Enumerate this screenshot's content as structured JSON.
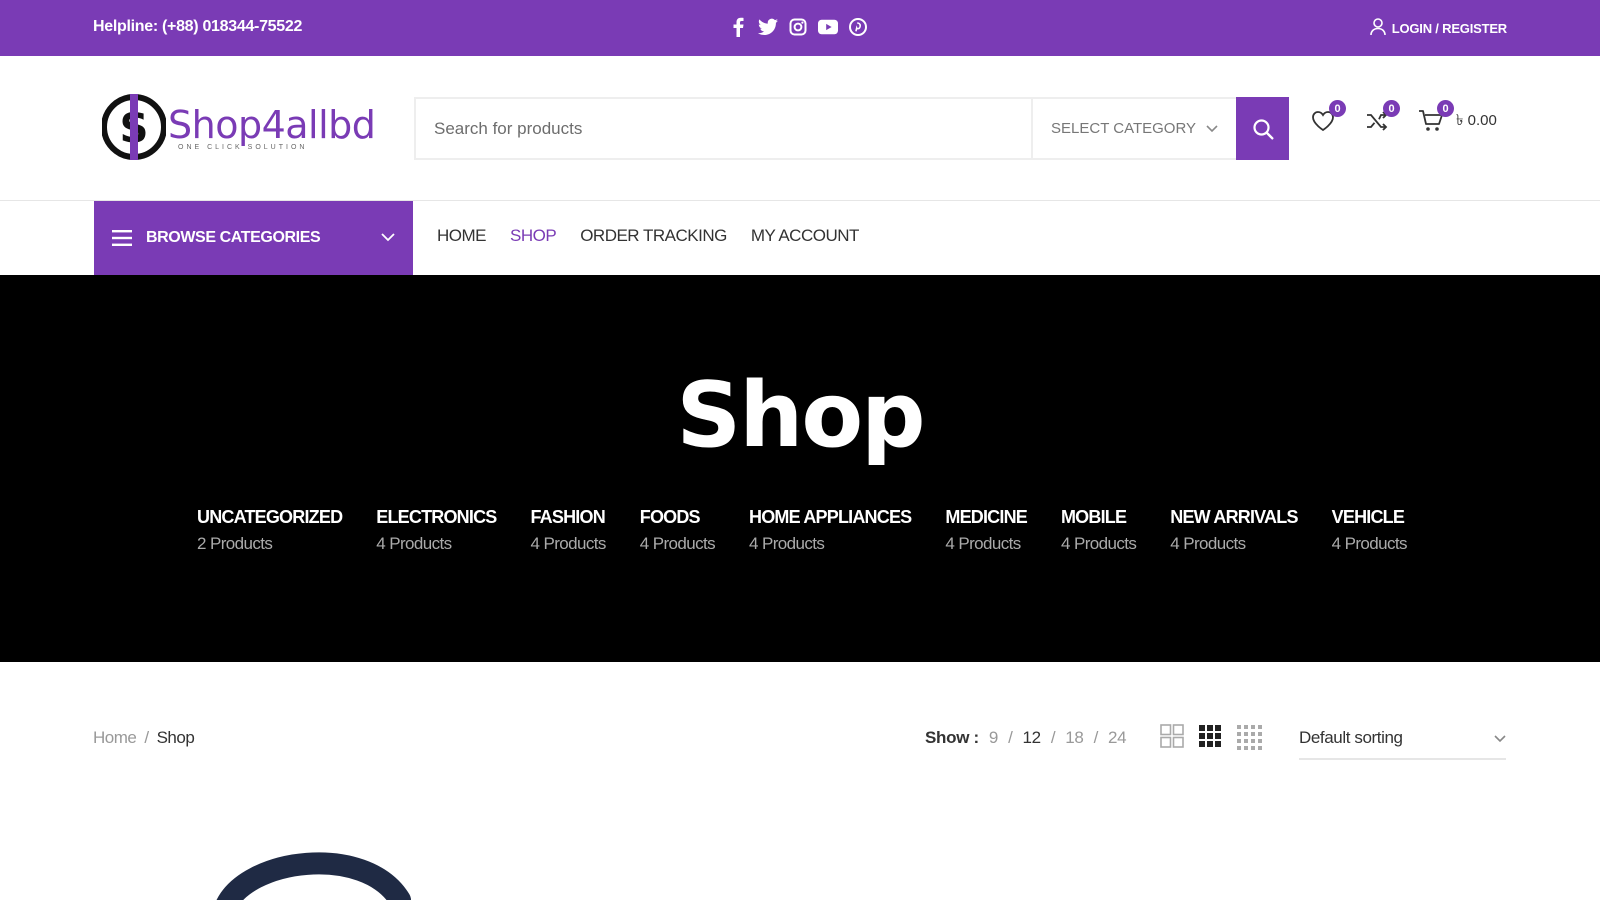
{
  "topbar": {
    "helpline": "Helpline: (+88) 018344-75522",
    "login_label": "LOGIN / REGISTER",
    "socials": [
      "facebook-icon",
      "twitter-icon",
      "instagram-icon",
      "youtube-icon",
      "pinterest-icon"
    ]
  },
  "header": {
    "logo": {
      "brand": "Shop4allbd",
      "tagline": "ONE CLICK SOLUTION"
    },
    "search": {
      "placeholder": "Search for products",
      "category_label": "SELECT CATEGORY"
    },
    "wishlist_count": "0",
    "compare_count": "0",
    "cart_count": "0",
    "cart_total": "৳ 0.00"
  },
  "nav": {
    "browse_label": "BROWSE CATEGORIES",
    "items": [
      {
        "label": "HOME",
        "active": false
      },
      {
        "label": "SHOP",
        "active": true
      },
      {
        "label": "ORDER TRACKING",
        "active": false
      },
      {
        "label": "MY ACCOUNT",
        "active": false
      }
    ]
  },
  "hero": {
    "title": "Shop",
    "categories": [
      {
        "name": "UNCATEGORIZED",
        "count": "2 Products"
      },
      {
        "name": "ELECTRONICS",
        "count": "4 Products"
      },
      {
        "name": "FASHION",
        "count": "4 Products"
      },
      {
        "name": "FOODS",
        "count": "4 Products"
      },
      {
        "name": "HOME APPLIANCES",
        "count": "4 Products"
      },
      {
        "name": "MEDICINE",
        "count": "4 Products"
      },
      {
        "name": "MOBILE",
        "count": "4 Products"
      },
      {
        "name": "NEW ARRIVALS",
        "count": "4 Products"
      },
      {
        "name": "VEHICLE",
        "count": "4 Products"
      }
    ]
  },
  "toolbar": {
    "breadcrumb": {
      "home": "Home",
      "separator": "/",
      "current": "Shop"
    },
    "show_label": "Show :",
    "per_page": [
      "9",
      "12",
      "18",
      "24"
    ],
    "per_page_active": "12",
    "sorting_label": "Default sorting"
  },
  "colors": {
    "accent": "#7a3bb5",
    "hero_bg": "#000000"
  }
}
